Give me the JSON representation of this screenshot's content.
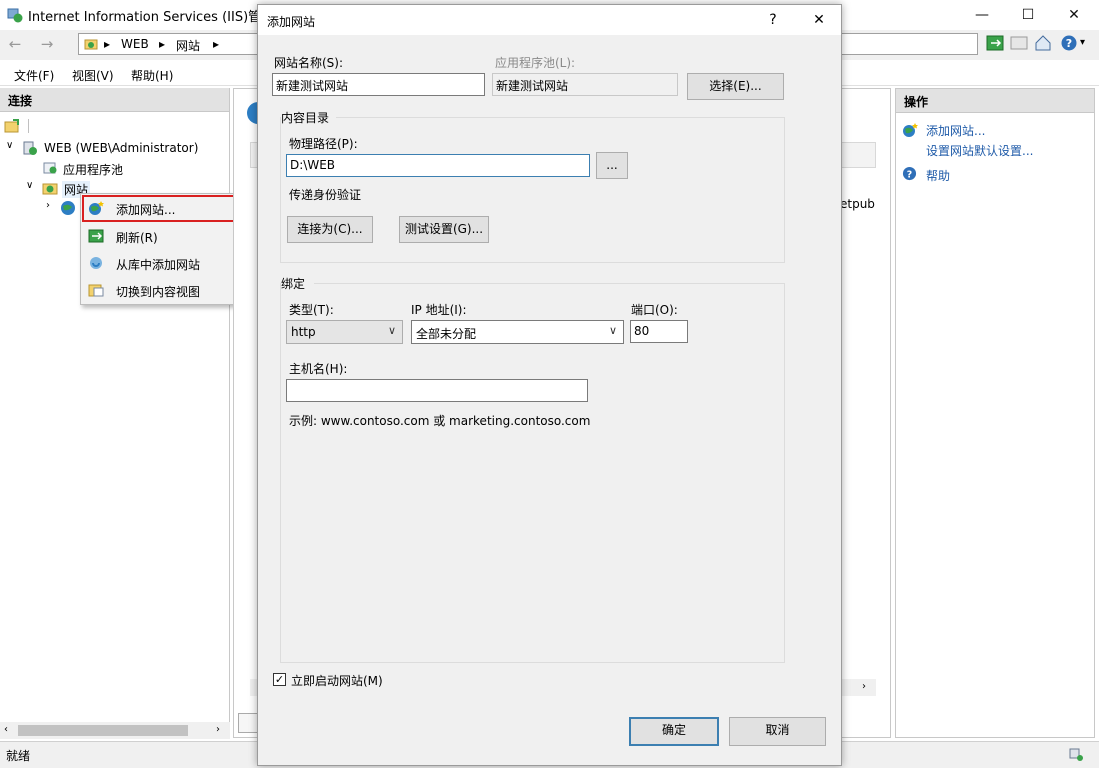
{
  "window": {
    "title": "Internet Information Services (IIS)管理器",
    "minimize": "—",
    "maximize": "☐",
    "close": "✕"
  },
  "address": {
    "back": "←",
    "forward": "→",
    "crumbs": [
      "WEB",
      "网站"
    ],
    "separator": "▸"
  },
  "menu": {
    "file": "文件(F)",
    "view": "视图(V)",
    "help": "帮助(H)"
  },
  "left_pane": {
    "header": "连接",
    "tree": {
      "server": "WEB (WEB\\Administrator)",
      "app_pools": "应用程序池",
      "sites": "网站"
    }
  },
  "context_menu": {
    "items": [
      "添加网站...",
      "刷新(R)",
      "从库中添加网站",
      "切换到内容视图"
    ]
  },
  "center_pane": {
    "partial_text": "etpub"
  },
  "right_pane": {
    "header": "操作",
    "add_site": "添加网站...",
    "set_defaults": "设置网站默认设置...",
    "help": "帮助"
  },
  "status_bar": {
    "text": "就绪"
  },
  "dialog": {
    "title": "添加网站",
    "help_btn": "?",
    "close_btn": "✕",
    "site_name_label": "网站名称(S):",
    "site_name_value": "新建测试网站",
    "app_pool_label": "应用程序池(L):",
    "app_pool_value": "新建测试网站",
    "select_button": "选择(E)...",
    "content_dir_group": "内容目录",
    "physical_path_label": "物理路径(P):",
    "physical_path_value": "D:\\WEB",
    "browse_button": "...",
    "pass_through_label": "传递身份验证",
    "connect_as_button": "连接为(C)...",
    "test_settings_button": "测试设置(G)...",
    "binding_group": "绑定",
    "type_label": "类型(T):",
    "type_value": "http",
    "ip_label": "IP 地址(I):",
    "ip_value": "全部未分配",
    "port_label": "端口(O):",
    "port_value": "80",
    "hostname_label": "主机名(H):",
    "hostname_value": "",
    "example_text": "示例: www.contoso.com 或 marketing.contoso.com",
    "start_now_checked": true,
    "start_now_label": "立即启动网站(M)",
    "start_now_check": "✓",
    "ok_button": "确定",
    "cancel_button": "取消"
  },
  "colors": {
    "accent": "#3c7fb1",
    "highlight_border": "#d92020",
    "link": "#1e5aa8"
  }
}
